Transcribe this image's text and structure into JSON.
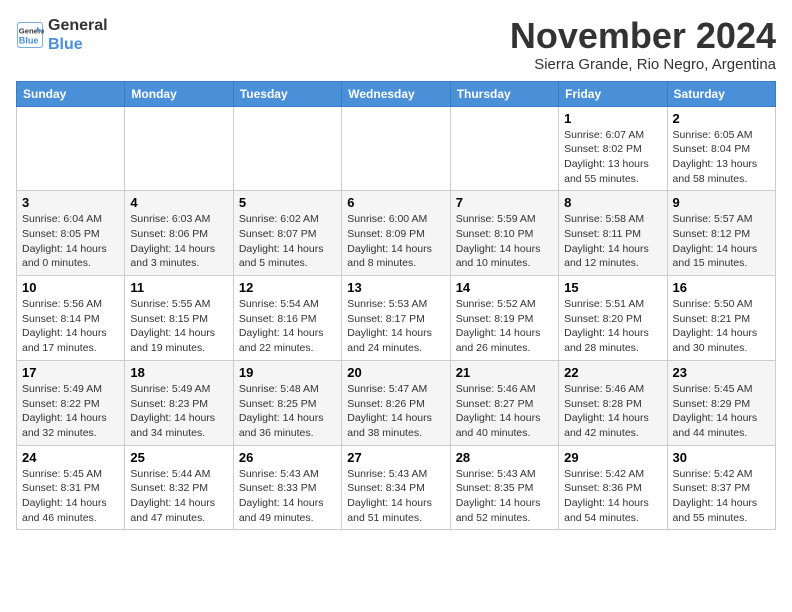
{
  "logo": {
    "line1": "General",
    "line2": "Blue"
  },
  "title": "November 2024",
  "subtitle": "Sierra Grande, Rio Negro, Argentina",
  "weekdays": [
    "Sunday",
    "Monday",
    "Tuesday",
    "Wednesday",
    "Thursday",
    "Friday",
    "Saturday"
  ],
  "weeks": [
    [
      {
        "day": "",
        "info": ""
      },
      {
        "day": "",
        "info": ""
      },
      {
        "day": "",
        "info": ""
      },
      {
        "day": "",
        "info": ""
      },
      {
        "day": "",
        "info": ""
      },
      {
        "day": "1",
        "info": "Sunrise: 6:07 AM\nSunset: 8:02 PM\nDaylight: 13 hours and 55 minutes."
      },
      {
        "day": "2",
        "info": "Sunrise: 6:05 AM\nSunset: 8:04 PM\nDaylight: 13 hours and 58 minutes."
      }
    ],
    [
      {
        "day": "3",
        "info": "Sunrise: 6:04 AM\nSunset: 8:05 PM\nDaylight: 14 hours and 0 minutes."
      },
      {
        "day": "4",
        "info": "Sunrise: 6:03 AM\nSunset: 8:06 PM\nDaylight: 14 hours and 3 minutes."
      },
      {
        "day": "5",
        "info": "Sunrise: 6:02 AM\nSunset: 8:07 PM\nDaylight: 14 hours and 5 minutes."
      },
      {
        "day": "6",
        "info": "Sunrise: 6:00 AM\nSunset: 8:09 PM\nDaylight: 14 hours and 8 minutes."
      },
      {
        "day": "7",
        "info": "Sunrise: 5:59 AM\nSunset: 8:10 PM\nDaylight: 14 hours and 10 minutes."
      },
      {
        "day": "8",
        "info": "Sunrise: 5:58 AM\nSunset: 8:11 PM\nDaylight: 14 hours and 12 minutes."
      },
      {
        "day": "9",
        "info": "Sunrise: 5:57 AM\nSunset: 8:12 PM\nDaylight: 14 hours and 15 minutes."
      }
    ],
    [
      {
        "day": "10",
        "info": "Sunrise: 5:56 AM\nSunset: 8:14 PM\nDaylight: 14 hours and 17 minutes."
      },
      {
        "day": "11",
        "info": "Sunrise: 5:55 AM\nSunset: 8:15 PM\nDaylight: 14 hours and 19 minutes."
      },
      {
        "day": "12",
        "info": "Sunrise: 5:54 AM\nSunset: 8:16 PM\nDaylight: 14 hours and 22 minutes."
      },
      {
        "day": "13",
        "info": "Sunrise: 5:53 AM\nSunset: 8:17 PM\nDaylight: 14 hours and 24 minutes."
      },
      {
        "day": "14",
        "info": "Sunrise: 5:52 AM\nSunset: 8:19 PM\nDaylight: 14 hours and 26 minutes."
      },
      {
        "day": "15",
        "info": "Sunrise: 5:51 AM\nSunset: 8:20 PM\nDaylight: 14 hours and 28 minutes."
      },
      {
        "day": "16",
        "info": "Sunrise: 5:50 AM\nSunset: 8:21 PM\nDaylight: 14 hours and 30 minutes."
      }
    ],
    [
      {
        "day": "17",
        "info": "Sunrise: 5:49 AM\nSunset: 8:22 PM\nDaylight: 14 hours and 32 minutes."
      },
      {
        "day": "18",
        "info": "Sunrise: 5:49 AM\nSunset: 8:23 PM\nDaylight: 14 hours and 34 minutes."
      },
      {
        "day": "19",
        "info": "Sunrise: 5:48 AM\nSunset: 8:25 PM\nDaylight: 14 hours and 36 minutes."
      },
      {
        "day": "20",
        "info": "Sunrise: 5:47 AM\nSunset: 8:26 PM\nDaylight: 14 hours and 38 minutes."
      },
      {
        "day": "21",
        "info": "Sunrise: 5:46 AM\nSunset: 8:27 PM\nDaylight: 14 hours and 40 minutes."
      },
      {
        "day": "22",
        "info": "Sunrise: 5:46 AM\nSunset: 8:28 PM\nDaylight: 14 hours and 42 minutes."
      },
      {
        "day": "23",
        "info": "Sunrise: 5:45 AM\nSunset: 8:29 PM\nDaylight: 14 hours and 44 minutes."
      }
    ],
    [
      {
        "day": "24",
        "info": "Sunrise: 5:45 AM\nSunset: 8:31 PM\nDaylight: 14 hours and 46 minutes."
      },
      {
        "day": "25",
        "info": "Sunrise: 5:44 AM\nSunset: 8:32 PM\nDaylight: 14 hours and 47 minutes."
      },
      {
        "day": "26",
        "info": "Sunrise: 5:43 AM\nSunset: 8:33 PM\nDaylight: 14 hours and 49 minutes."
      },
      {
        "day": "27",
        "info": "Sunrise: 5:43 AM\nSunset: 8:34 PM\nDaylight: 14 hours and 51 minutes."
      },
      {
        "day": "28",
        "info": "Sunrise: 5:43 AM\nSunset: 8:35 PM\nDaylight: 14 hours and 52 minutes."
      },
      {
        "day": "29",
        "info": "Sunrise: 5:42 AM\nSunset: 8:36 PM\nDaylight: 14 hours and 54 minutes."
      },
      {
        "day": "30",
        "info": "Sunrise: 5:42 AM\nSunset: 8:37 PM\nDaylight: 14 hours and 55 minutes."
      }
    ]
  ]
}
